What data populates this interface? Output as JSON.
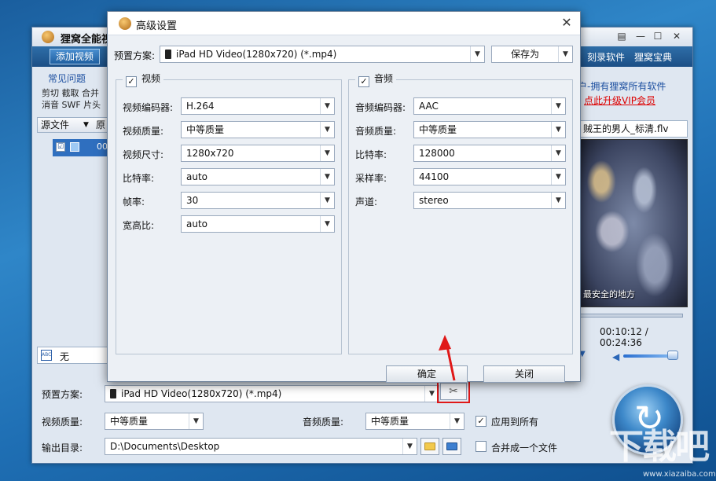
{
  "main_window": {
    "title": "狸窝全能视",
    "controls": [
      "▤",
      "—",
      "☐",
      "✕"
    ],
    "add_video_label": "添加视频",
    "menu_right": [
      "刻录软件",
      "狸窝宝典"
    ],
    "side": {
      "title": "常见问题",
      "tools_row1": "剪切 截取 合并",
      "tools_row2": "消音 SWF 片头"
    },
    "list": {
      "header_col1": "源文件",
      "header_col2": "原",
      "row_number": "00",
      "row_checked": "☑"
    },
    "subtitle_value": "无",
    "vip_text": "户-拥有狸窝所有软件",
    "vip_link": "点此升级VIP会员",
    "preview_file": "贼王的男人_标清.flv",
    "preview_caption": "最安全的地方",
    "time_display": "00:10:12 / 00:24:36",
    "bottom": {
      "preset_label": "预置方案:",
      "preset_value": "iPad HD Video(1280x720) (*.mp4)",
      "video_quality_label": "视频质量:",
      "video_quality_value": "中等质量",
      "audio_quality_label": "音频质量:",
      "audio_quality_value": "中等质量",
      "apply_all_label": "应用到所有",
      "output_label": "输出目录:",
      "output_value": "D:\\Documents\\Desktop",
      "merge_label": "合并成一个文件"
    },
    "watermark": "下载吧",
    "watermark_url": "www.xiazaiba.com"
  },
  "dialog": {
    "title": "高级设置",
    "preset_label": "预置方案:",
    "preset_value": "iPad HD Video(1280x720) (*.mp4)",
    "save_as_label": "保存为",
    "video": {
      "legend": "视频",
      "fields": [
        {
          "label": "视频编码器:",
          "value": "H.264"
        },
        {
          "label": "视频质量:",
          "value": "中等质量"
        },
        {
          "label": "视频尺寸:",
          "value": "1280x720"
        },
        {
          "label": "比特率:",
          "value": "auto"
        },
        {
          "label": "帧率:",
          "value": "30"
        },
        {
          "label": "宽高比:",
          "value": "auto"
        }
      ]
    },
    "audio": {
      "legend": "音频",
      "fields": [
        {
          "label": "音频编码器:",
          "value": "AAC"
        },
        {
          "label": "音频质量:",
          "value": "中等质量"
        },
        {
          "label": "比特率:",
          "value": "128000"
        },
        {
          "label": "采样率:",
          "value": "44100"
        },
        {
          "label": "声道:",
          "value": "stereo"
        }
      ]
    },
    "ok_label": "确定",
    "close_label": "关闭"
  },
  "colors": {
    "highlight": "#e01818",
    "accent": "#1f5fa0",
    "link": "#dd0000"
  }
}
